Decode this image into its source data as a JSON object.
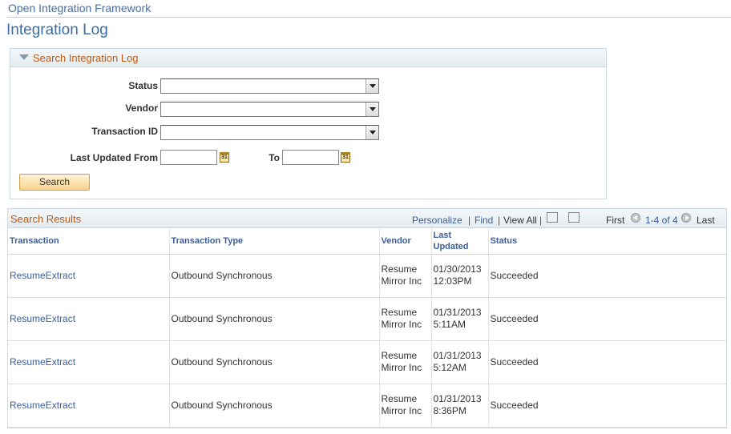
{
  "breadcrumb": "Open Integration Framework",
  "page_title": "Integration Log",
  "search_panel": {
    "title": "Search Integration Log",
    "status_label": "Status",
    "vendor_label": "Vendor",
    "transaction_id_label": "Transaction ID",
    "last_updated_from_label": "Last Updated From",
    "to_label": "To",
    "status_value": "",
    "vendor_value": "",
    "transaction_id_value": "",
    "from_date_value": "",
    "to_date_value": "",
    "search_button": "Search",
    "calendar_glyph": "31"
  },
  "results": {
    "title": "Search Results",
    "personalize": "Personalize",
    "find": "Find",
    "sep": "|",
    "view_all": "View All",
    "first": "First",
    "range": "1-4 of 4",
    "last": "Last",
    "columns": {
      "transaction": "Transaction",
      "transaction_type": "Transaction Type",
      "vendor": "Vendor",
      "last_updated_line1": "Last",
      "last_updated_line2": "Updated",
      "status": "Status"
    },
    "rows": [
      {
        "transaction": "ResumeExtract",
        "type": "Outbound Synchronous",
        "vendor1": "Resume",
        "vendor2": "Mirror Inc",
        "date": "01/30/2013",
        "time": "12:03PM",
        "status": "Succeeded"
      },
      {
        "transaction": "ResumeExtract",
        "type": "Outbound Synchronous",
        "vendor1": "Resume",
        "vendor2": "Mirror Inc",
        "date": "01/31/2013",
        "time": "5:11AM",
        "status": "Succeeded"
      },
      {
        "transaction": "ResumeExtract",
        "type": "Outbound Synchronous",
        "vendor1": "Resume",
        "vendor2": "Mirror Inc",
        "date": "01/31/2013",
        "time": "5:12AM",
        "status": "Succeeded"
      },
      {
        "transaction": "ResumeExtract",
        "type": "Outbound Synchronous",
        "vendor1": "Resume",
        "vendor2": "Mirror Inc",
        "date": "01/31/2013",
        "time": "8:36PM",
        "status": "Succeeded"
      }
    ]
  },
  "colors": {
    "link": "#3b5e9a",
    "panel_title": "#b85a18",
    "page_title": "#3b6ea5",
    "button_bg": "#f9d38e"
  },
  "icons": {
    "collapse": "triangle-down-icon",
    "calendar": "calendar-icon",
    "zoom": "new-window-icon",
    "download": "grid-download-icon",
    "previous": "previous-arrow-icon",
    "next": "next-arrow-icon"
  }
}
